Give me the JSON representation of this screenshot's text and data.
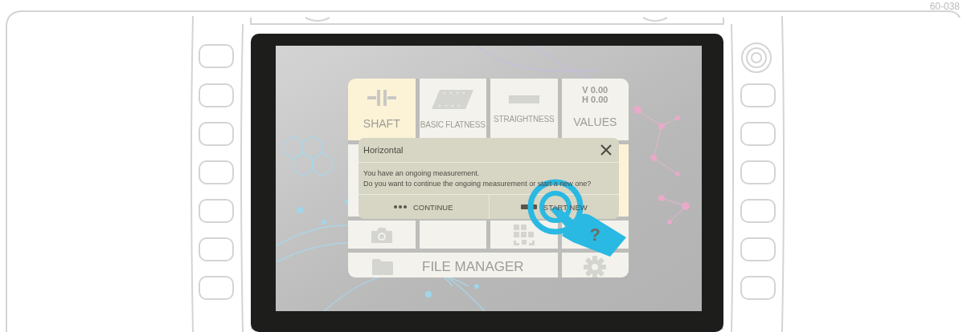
{
  "figure_number": "60-038",
  "tile_rows": [
    [
      {
        "kind": "shaft",
        "label": "SHAFT",
        "selected": true
      },
      {
        "kind": "flatness",
        "label": "BASIC FLATNESS",
        "selected": false
      },
      {
        "kind": "straightness",
        "label": "STRAIGHTNESS",
        "selected": false
      },
      {
        "kind": "values",
        "label": "VALUES",
        "value_lines": [
          "V 0.00",
          "H 0.00"
        ],
        "selected": false
      }
    ],
    [
      {
        "kind": "blank",
        "selected": false
      },
      {
        "kind": "blank",
        "selected": true
      }
    ],
    [
      {
        "kind": "camera",
        "selected": false
      },
      {
        "kind": "blank",
        "selected": false
      },
      {
        "kind": "qr",
        "selected": false
      },
      {
        "kind": "help",
        "label": "?",
        "selected": false
      }
    ],
    [
      {
        "kind": "files",
        "label": "FILE MANAGER",
        "selected": false
      },
      {
        "kind": "settings",
        "selected": false
      }
    ]
  ],
  "dialog": {
    "title": "Horizontal",
    "message": [
      "You have an ongoing measurement.",
      "Do you want to continue the ongoing measurement or start a new one?"
    ],
    "buttons": [
      {
        "kind": "continue",
        "label": "CONTINUE"
      },
      {
        "kind": "start_new",
        "label": "START NEW"
      }
    ]
  }
}
